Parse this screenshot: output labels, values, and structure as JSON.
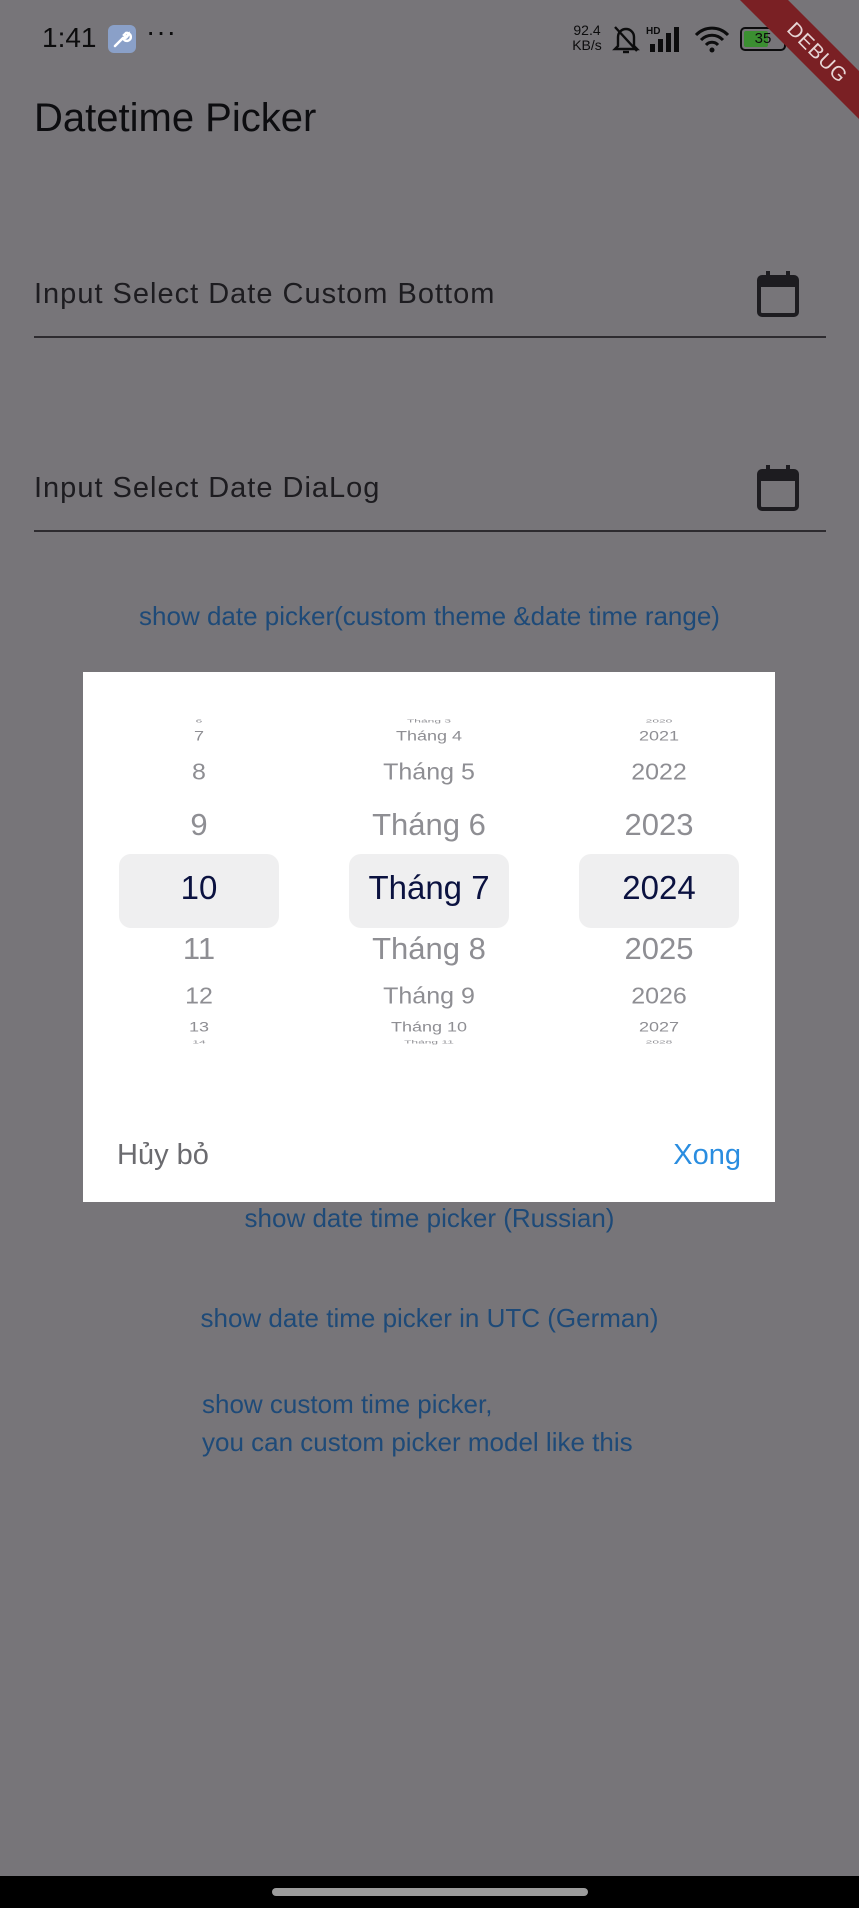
{
  "status_bar": {
    "time": "1:41",
    "speed_top": "92.4",
    "speed_bottom": "KB/s",
    "battery": "35",
    "icons": [
      "wrench-icon",
      "more-dots-icon",
      "mute-bell-icon",
      "hd-signal-icon",
      "wifi-icon",
      "battery-icon"
    ]
  },
  "debug_banner": "DEBUG",
  "app": {
    "title": "Datetime Picker",
    "field_bottom": "Input Select Date Custom Bottom",
    "field_dialog": "Input Select Date DiaLog",
    "btn_custom_theme": "show date picker(custom theme &date time range)",
    "btn_russian": "show date time picker (Russian)",
    "btn_german": "show date time picker in UTC (German)",
    "btn_custom_line1": "show custom time picker,",
    "btn_custom_line2": "you can custom picker model like this"
  },
  "picker": {
    "days": [
      "6",
      "7",
      "8",
      "9",
      "10",
      "11",
      "12",
      "13",
      "14"
    ],
    "months": [
      "Tháng 3",
      "Tháng 4",
      "Tháng 5",
      "Tháng 6",
      "Tháng 7",
      "Tháng 8",
      "Tháng 9",
      "Tháng 10",
      "Tháng 11"
    ],
    "years": [
      "2020",
      "2021",
      "2022",
      "2023",
      "2024",
      "2025",
      "2026",
      "2027",
      "2028"
    ],
    "selected_day": "10",
    "selected_month": "Tháng 7",
    "selected_year": "2024",
    "cancel_label": "Hủy bỏ",
    "done_label": "Xong"
  },
  "colors": {
    "scrim": "#777579",
    "accent": "#2a8de0",
    "link": "#1e4a78",
    "debug": "#7a2024"
  }
}
